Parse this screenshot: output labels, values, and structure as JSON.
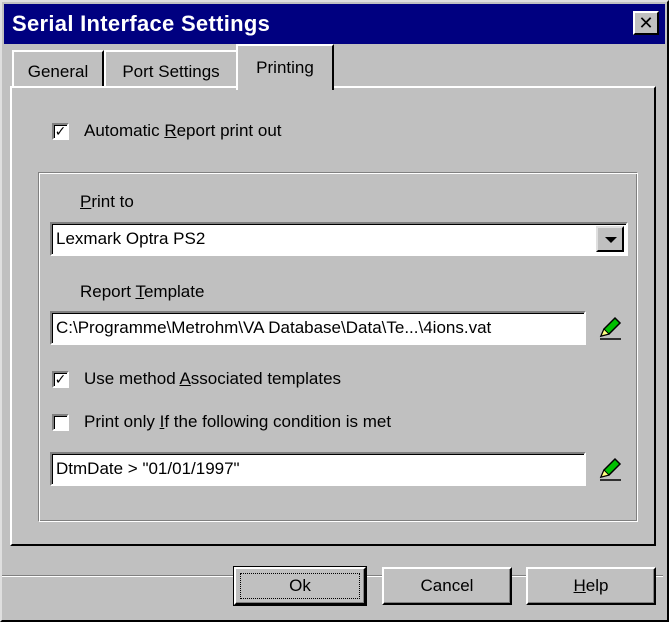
{
  "window": {
    "title": "Serial Interface Settings"
  },
  "tabs": [
    {
      "label": "General",
      "active": false
    },
    {
      "label": "Port Settings",
      "active": false
    },
    {
      "label": "Printing",
      "active": true
    }
  ],
  "auto_print": {
    "checked": true,
    "label_pre": "Automatic ",
    "label_key": "R",
    "label_post": "eport print out"
  },
  "print_to": {
    "label_key": "P",
    "label_post": "rint to",
    "value": "Lexmark Optra PS2"
  },
  "report_template": {
    "label_pre": "Report ",
    "label_key": "T",
    "label_post": "emplate",
    "value": "C:\\Programme\\Metrohm\\VA Database\\Data\\Te...\\4ions.vat"
  },
  "use_assoc": {
    "checked": true,
    "label_pre": "Use method ",
    "label_key": "A",
    "label_post": "ssociated templates"
  },
  "print_only_if": {
    "checked": false,
    "label_pre": "Print only ",
    "label_key": "I",
    "label_post": "f the following condition is met"
  },
  "condition": {
    "value": "DtmDate > \"01/01/1997\""
  },
  "buttons": {
    "ok": "Ok",
    "cancel": "Cancel",
    "help_key": "H",
    "help_post": "elp"
  },
  "icons": {
    "close": "close-icon",
    "edit": "pencil-icon",
    "dropdown": "chevron-down-icon"
  },
  "colors": {
    "titlebar": "#000080",
    "title_text": "#ffffff",
    "face": "#c0c0c0",
    "pencil": "#00c000"
  }
}
